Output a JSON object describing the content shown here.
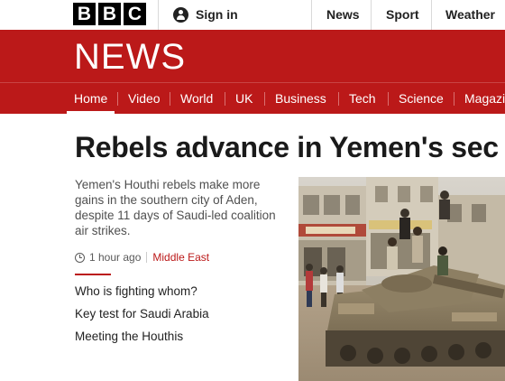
{
  "header": {
    "logo_letters": [
      "B",
      "B",
      "C"
    ],
    "signin_label": "Sign in",
    "top_links": [
      "News",
      "Sport",
      "Weather"
    ]
  },
  "section_title": "NEWS",
  "nav": {
    "items": [
      "Home",
      "Video",
      "World",
      "UK",
      "Business",
      "Tech",
      "Science",
      "Magazi"
    ],
    "active": "Home"
  },
  "article": {
    "headline": "Rebels advance in Yemen's sec",
    "summary": "Yemen's Houthi rebels make more gains in the southern city of Aden, despite 11 days of Saudi-led coalition air strikes.",
    "time": "1 hour ago",
    "category": "Middle East",
    "related": [
      "Who is fighting whom?",
      "Key test for Saudi Arabia",
      "Meeting the Houthis"
    ]
  },
  "colors": {
    "brand_red": "#bb1919",
    "text_dark": "#1a1a1a",
    "text_grey": "#505050"
  }
}
